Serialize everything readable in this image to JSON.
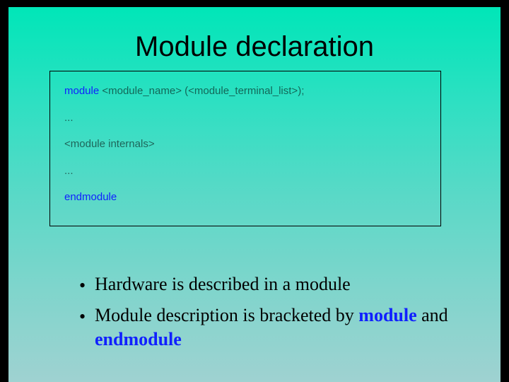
{
  "title": "Module declaration",
  "code": {
    "l1_kw": "module",
    "l1_rest": "  <module_name> (<module_terminal_list>);",
    "l2": "...",
    "l3": "<module internals>",
    "l4": "...",
    "l5_kw": "endmodule"
  },
  "bullets": {
    "b1": "Hardware is described in a module",
    "b2_pre": "Module description is bracketed by ",
    "b2_kw1": "module",
    "b2_mid": " and ",
    "b2_kw2": "endmodule"
  }
}
